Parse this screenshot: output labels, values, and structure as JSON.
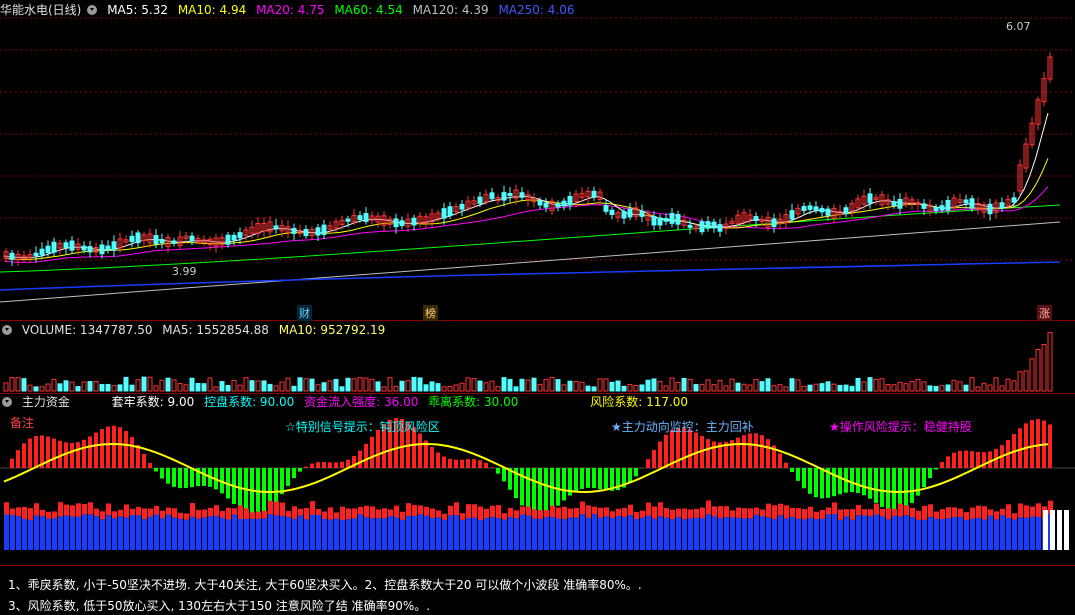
{
  "main": {
    "title": "华能水电(日线)",
    "ma": [
      {
        "label": "MA5: 5.32",
        "color": "#ffffff"
      },
      {
        "label": "MA10: 4.94",
        "color": "#ffff00"
      },
      {
        "label": "MA20: 4.75",
        "color": "#ff00ff"
      },
      {
        "label": "MA60: 4.54",
        "color": "#00ff00"
      },
      {
        "label": "MA120: 4.39",
        "color": "#c0c0c0"
      },
      {
        "label": "MA250: 4.06",
        "color": "#3b5bff"
      }
    ],
    "price_high": "6.07",
    "price_low": "3.99",
    "tag_cai": "财",
    "tag_bang": "榜",
    "tag_zhang": "涨"
  },
  "volume": {
    "label": "VOLUME: 1347787.50",
    "ma5": "MA5: 1552854.88",
    "ma10": "MA10: 952792.19"
  },
  "indicator": {
    "title": "主力资金",
    "params": [
      {
        "label": "套牢系数: 9.00",
        "color": "#ffffff"
      },
      {
        "label": "控盘系数: 90.00",
        "color": "#00ffff"
      },
      {
        "label": "资金流入强度: 36.00",
        "color": "#ff00ff"
      },
      {
        "label": "乖离系数: 30.00",
        "color": "#00ff00"
      },
      {
        "label": "风险系数: 117.00",
        "color": "#ffff00"
      }
    ],
    "note_label": "备注",
    "signal_hint": "☆特别信号提示：钝顶风险区",
    "main_monitor": "★主力动向监控：主力回补",
    "op_hint": "★操作风险提示：稳健持股"
  },
  "footer": {
    "line1": "1、乖戾系数, 小于-50坚决不进场. 大于40关注, 大于60坚决买入。2、控盘系数大于20 可以做个小波段 准确率80%。.",
    "line2": "3、风险系数, 低于50放心买入, 130左右大于150 注意风险了结 准确率90%。."
  },
  "colors": {
    "up": "#ff3333",
    "down": "#54ffff",
    "grid": "#8b0000",
    "bull": "#ff2020",
    "bear": "#00ff00",
    "hold_blue": "#1a3cff",
    "curve_yellow": "#ffff00"
  }
}
